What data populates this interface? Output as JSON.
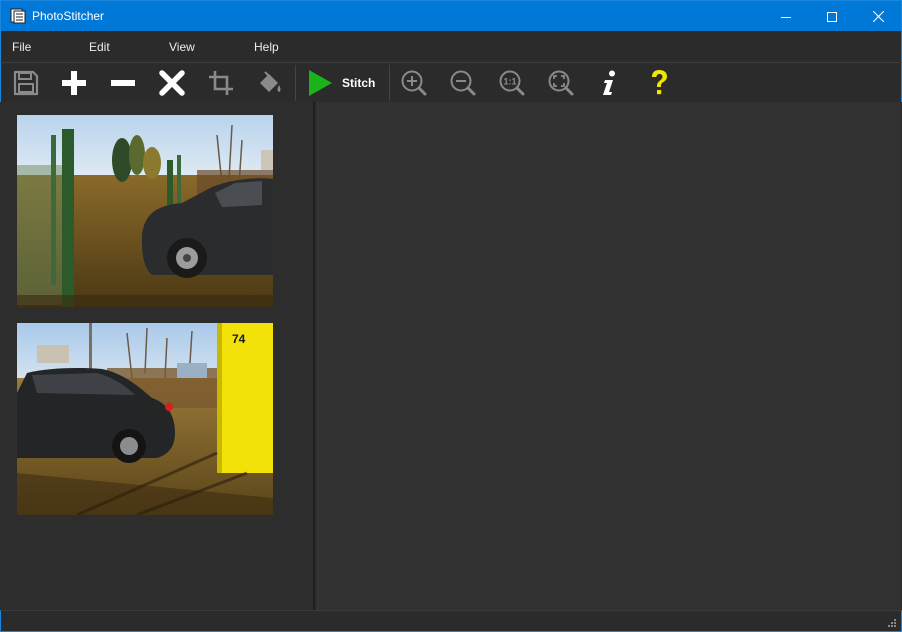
{
  "window": {
    "title": "PhotoStitcher"
  },
  "menu": {
    "items": [
      "File",
      "Edit",
      "View",
      "Help"
    ]
  },
  "toolbar": {
    "stitch_label": "Stitch",
    "buttons": [
      "save-icon",
      "add-icon",
      "remove-icon",
      "clear-icon",
      "crop-icon",
      "fill-icon",
      "play-icon",
      "zoom-in-icon",
      "zoom-out-icon",
      "zoom-actual-icon",
      "zoom-fit-icon",
      "info-icon",
      "help-icon"
    ]
  },
  "thumbnails": {
    "second_badge": "74"
  },
  "colors": {
    "titlebar": "#0078d7",
    "background": "#2b2b2b",
    "stitch_green": "#1ab31a",
    "help_yellow": "#f2e600"
  }
}
